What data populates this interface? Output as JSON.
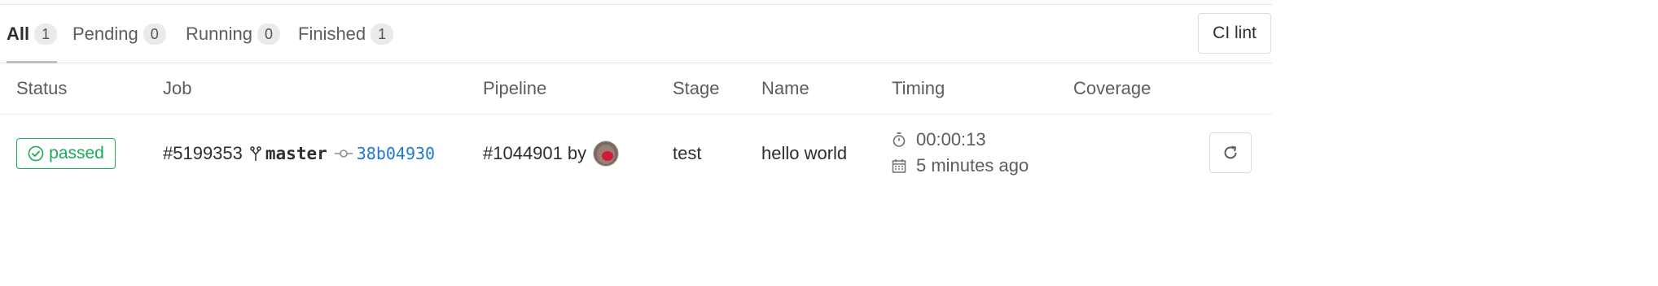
{
  "tabs": [
    {
      "label": "All",
      "count": "1",
      "active": true
    },
    {
      "label": "Pending",
      "count": "0"
    },
    {
      "label": "Running",
      "count": "0"
    },
    {
      "label": "Finished",
      "count": "1"
    }
  ],
  "toolbar": {
    "ci_lint_label": "CI lint"
  },
  "table": {
    "headers": [
      "Status",
      "Job",
      "Pipeline",
      "Stage",
      "Name",
      "Timing",
      "Coverage"
    ],
    "rows": [
      {
        "status": "passed",
        "job_id": "#5199353",
        "branch": "master",
        "commit": "38b04930",
        "pipeline": "#1044901",
        "pipeline_by": "by",
        "stage": "test",
        "name": "hello world",
        "duration": "00:00:13",
        "finished_ago": "5 minutes ago"
      }
    ]
  },
  "icons": {
    "status": "check-circle-icon",
    "branch": "branch-icon",
    "commit": "commit-icon",
    "duration": "stopwatch-icon",
    "finished": "calendar-icon",
    "retry": "retry-icon"
  },
  "colors": {
    "success": "#1aaa55",
    "link": "#1f78d1"
  }
}
